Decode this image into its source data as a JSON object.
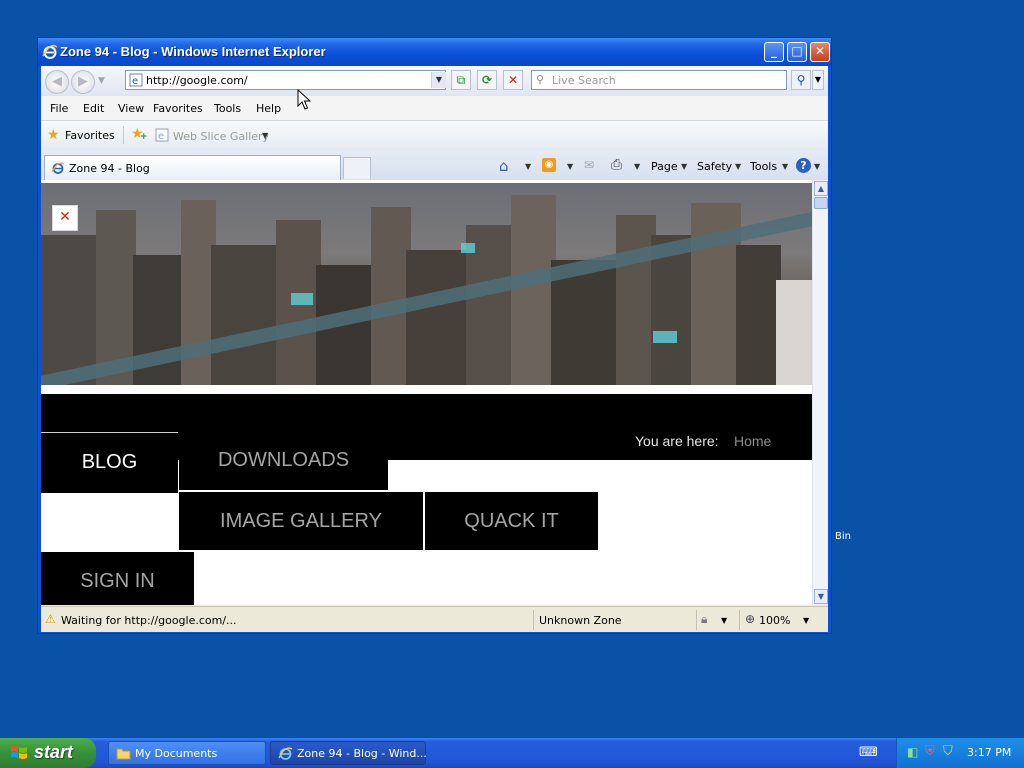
{
  "window": {
    "title": "Zone 94 - Blog - Windows Internet Explorer",
    "min_glyph": "_",
    "max_glyph": "□",
    "close_glyph": "✕"
  },
  "address_bar": {
    "url": "http://google.com/"
  },
  "search": {
    "placeholder": "Live Search"
  },
  "menu": {
    "items": [
      "File",
      "Edit",
      "View",
      "Favorites",
      "Tools",
      "Help"
    ]
  },
  "favorites_bar": {
    "favorites_label": "Favorites",
    "web_slice_label": "Web Slice Gallery"
  },
  "tabs": {
    "active_label": "Zone 94 - Blog"
  },
  "command_bar": {
    "page_label": "Page",
    "safety_label": "Safety",
    "tools_label": "Tools"
  },
  "page": {
    "breadcrumb_label": "You are here:",
    "breadcrumb_home": "Home",
    "nav": {
      "blog": "BLOG",
      "downloads": "DOWNLOADS",
      "image_gallery": "IMAGE GALLERY",
      "quack_it": "QUACK IT",
      "sign_in": "SIGN IN"
    }
  },
  "status_bar": {
    "status_text": "Waiting for http://google.com/...",
    "zone": "Unknown Zone",
    "zoom": "100%"
  },
  "desktop": {
    "partial_label": "Bin"
  },
  "taskbar": {
    "start_label": "start",
    "tasks": [
      "My Documents",
      "Zone 94 - Blog - Wind..."
    ],
    "clock": "3:17 PM"
  },
  "colors": {
    "desktop": "#0a52a8",
    "titlebar": "#0a4fd6",
    "page_nav_bg": "#000000",
    "start_button": "#37903b"
  }
}
